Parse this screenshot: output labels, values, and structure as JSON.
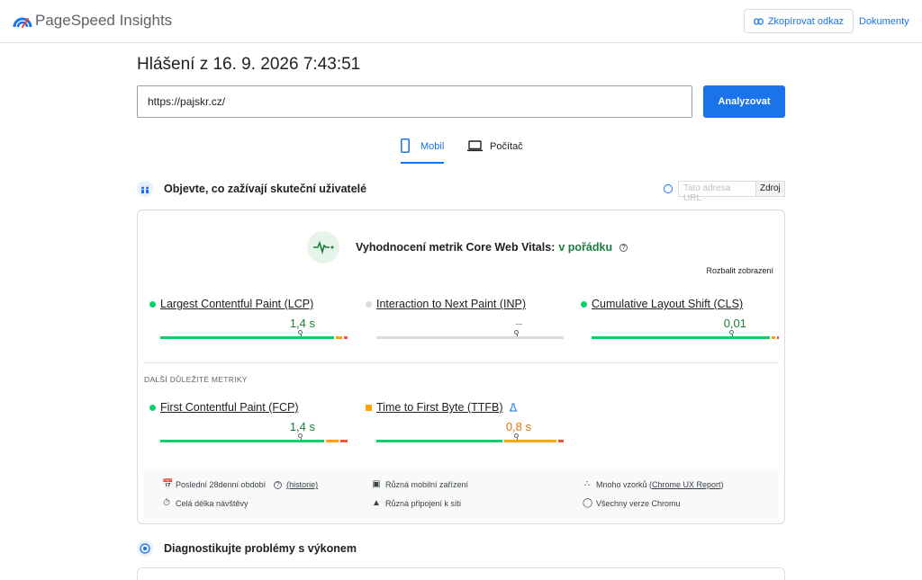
{
  "header": {
    "brand": "PageSpeed Insights",
    "copy_link_label": "Zkopírovat odkaz",
    "docs_label": "Dokumenty"
  },
  "report": {
    "title": "Hlášení z 16. 9. 2026 7:43:51",
    "url_value": "https://pajskr.cz/",
    "analyze_label": "Analyzovat"
  },
  "tabs": [
    {
      "label": "Mobil",
      "active": true
    },
    {
      "label": "Počítač",
      "active": false
    }
  ],
  "field": {
    "heading": "Objevte, co zažívají skuteční uživatelé",
    "url_placeholder": "Tato adresa URL",
    "source_label": "Zdroj",
    "cwv_prefix": "Vyhodnocení metrik Core Web Vitals:",
    "cwv_status": "v pořádku",
    "expand_label": "Rozbalit zobrazení",
    "metrics": [
      {
        "name": "Largest Contentful Paint (LCP)",
        "value": "1,4 s",
        "status": "good"
      },
      {
        "name": "Interaction to Next Paint (INP)",
        "value": "–",
        "status": "none"
      },
      {
        "name": "Cumulative Layout Shift (CLS)",
        "value": "0,01",
        "status": "good"
      }
    ],
    "other_heading": "DALŠÍ DŮLEŽITÉ METRIKY",
    "other_metrics": [
      {
        "name": "First Contentful Paint (FCP)",
        "value": "1,4 s",
        "status": "good"
      },
      {
        "name": "Time to First Byte (TTFB)",
        "value": "0,8 s",
        "status": "average"
      }
    ],
    "footer": {
      "period": "Poslední 28denní období",
      "history": "(historie)",
      "devices": "Různá mobilní zařízení",
      "samples_prefix": "Mnoho vzorků (",
      "samples_link": "Chrome UX Report",
      "samples_suffix": ")",
      "duration": "Celá délka návštěvy",
      "connections": "Různá připojení k síti",
      "versions": "Všechny verze Chromu"
    }
  },
  "diagnostics": {
    "heading": "Diagnostikujte problémy s výkonem"
  },
  "colors": {
    "accent": "#1a73e8",
    "good": "#0cce6b",
    "average": "#ffa400",
    "poor": "#ff4e42",
    "none": "#dadce0"
  }
}
